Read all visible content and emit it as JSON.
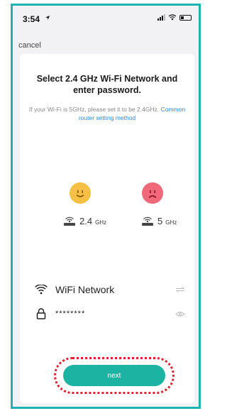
{
  "status_bar": {
    "time": "3:54"
  },
  "nav": {
    "cancel_label": "cancel"
  },
  "card": {
    "title": "Select 2.4 GHz Wi-Fi Network and enter password.",
    "subtitle": "If your Wi-Fi is 5GHz, please set it to be 2.4GHz.",
    "subtitle_link": "Common router setting method"
  },
  "bands": [
    {
      "value": "2.4",
      "unit": "GHz",
      "face": "happy-face-icon",
      "color": "#f5c043"
    },
    {
      "value": "5",
      "unit": "GHz",
      "face": "sad-face-icon",
      "color": "#f0697b"
    }
  ],
  "form": {
    "wifi_network": "WiFi Network",
    "password": "********"
  },
  "actions": {
    "next_label": "next"
  },
  "colors": {
    "accent": "#1cb3a3",
    "frame": "#1cb3b0",
    "highlight": "#e0202e"
  }
}
